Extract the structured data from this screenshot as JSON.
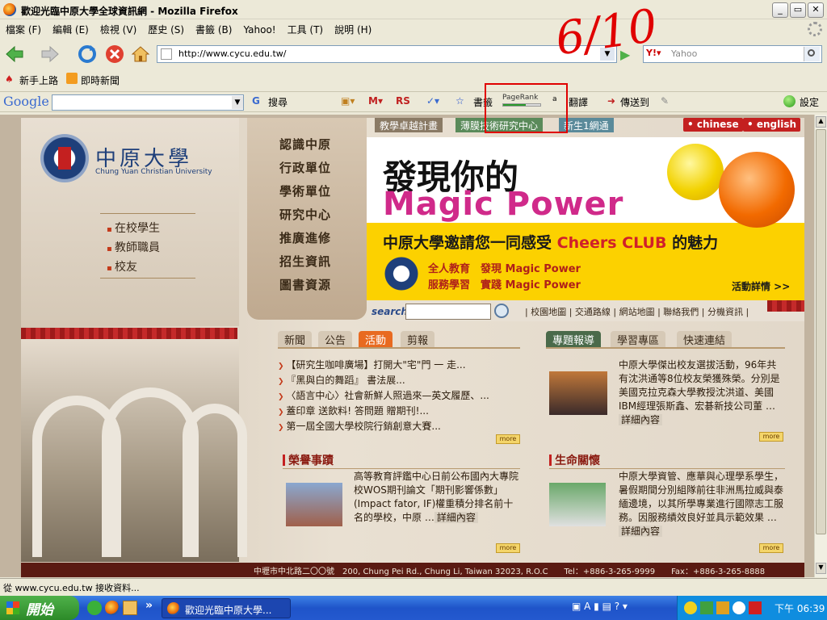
{
  "window": {
    "title": "歡迎光臨中原大學全球資訊網 - Mozilla Firefox",
    "min": "_",
    "max": "▭",
    "close": "✕"
  },
  "menu": [
    "檔案 (F)",
    "編輯 (E)",
    "檢視 (V)",
    "歷史 (S)",
    "書籤 (B)",
    "Yahoo!",
    "工具 (T)",
    "說明 (H)"
  ],
  "nav": {
    "url": "http://www.cycu.edu.tw/",
    "yahoo_placeholder": "Yahoo"
  },
  "bookmarks": [
    "新手上路",
    "即時新聞"
  ],
  "google_toolbar": {
    "logo": "Google",
    "search": "搜尋",
    "rs": "RS",
    "bookmarks": "書籤",
    "pagerank": "PageRank",
    "translate": "翻譯",
    "sendto": "傳送到",
    "settings": "設定"
  },
  "site": {
    "logo_cn": "中原大學",
    "logo_en": "Chung Yuan Christian University",
    "left_links": [
      "在校學生",
      "教師職員",
      "校友"
    ],
    "nav_items": [
      "認識中原",
      "行政單位",
      "學術單位",
      "研究中心",
      "推廣進修",
      "招生資訊",
      "圖書資源"
    ],
    "top_tabs": [
      "教學卓越計畫",
      "薄膜技術研究中心",
      "新生1網通"
    ],
    "lang": [
      "• chinese",
      "• english"
    ],
    "banner": {
      "line1": "發現你的",
      "line2": "Magic Power",
      "line3a": "中原大學邀請您一同感受 ",
      "line3b": "Cheers CLUB",
      "line3c": " 的魅力",
      "sub1a": "全人教育",
      "sub1b": "發現 Magic Power",
      "sub2a": "服務學習",
      "sub2b": "實踐 Magic Power",
      "more": "活動詳情 >>"
    },
    "search_label": "search",
    "quick_links": "| 校園地圖 | 交通路線 | 網站地圖 | 聯絡我們 | 分機資訊 |",
    "news_tabs": [
      "新聞",
      "公告",
      "活動",
      "剪報"
    ],
    "news_items": [
      "【研究生咖啡廣場】打開大\"宅\"門 一 走...",
      "『黑與白的舞蹈』 書法展...",
      "〈語言中心〉社會新鮮人照過來—英文履歷、...",
      "蓋印章 送飲料! 答問題 贈期刊!...",
      "第一屆全國大學校院行銷創意大賽..."
    ],
    "right_tabs": [
      "專題報導",
      "學習專區",
      "快速連結"
    ],
    "feature_text": "中原大學傑出校友選拔活動，96年共有沈洪通等8位校友榮獲殊榮。分別是美國克拉克森大學教授沈洪道、美國IBM經理張斯鑫、宏碁新技公司董",
    "detail": "詳細內容",
    "more": "more",
    "honor_title": "榮譽事蹟",
    "honor_text": "高等教育評鑑中心日前公布國內大專院校WOS期刊論文「期刊影響係數」(Impact fator, IF)權重積分排名前十名的學校，中原",
    "life_title": "生命關懷",
    "life_text": "中原大學資管、應華與心理學系學生，暑假期間分別組隊前往非洲馬拉威與泰緬邊境，以其所學專業進行國際志工服務。因服務績效良好並具示範效果",
    "footer": "中壢市中北路二〇〇號　200, Chung Pei Rd., Chung Li, Taiwan 32023, R.O.C　　Tel：+886-3-265-9999　　Fax：+886-3-265-8888"
  },
  "status": "從 www.cycu.edu.tw 接收資料...",
  "taskbar": {
    "start": "開始",
    "task": "歡迎光臨中原大學...",
    "clock": "下午 06:39",
    "more": "»"
  },
  "annotation": "6/10"
}
